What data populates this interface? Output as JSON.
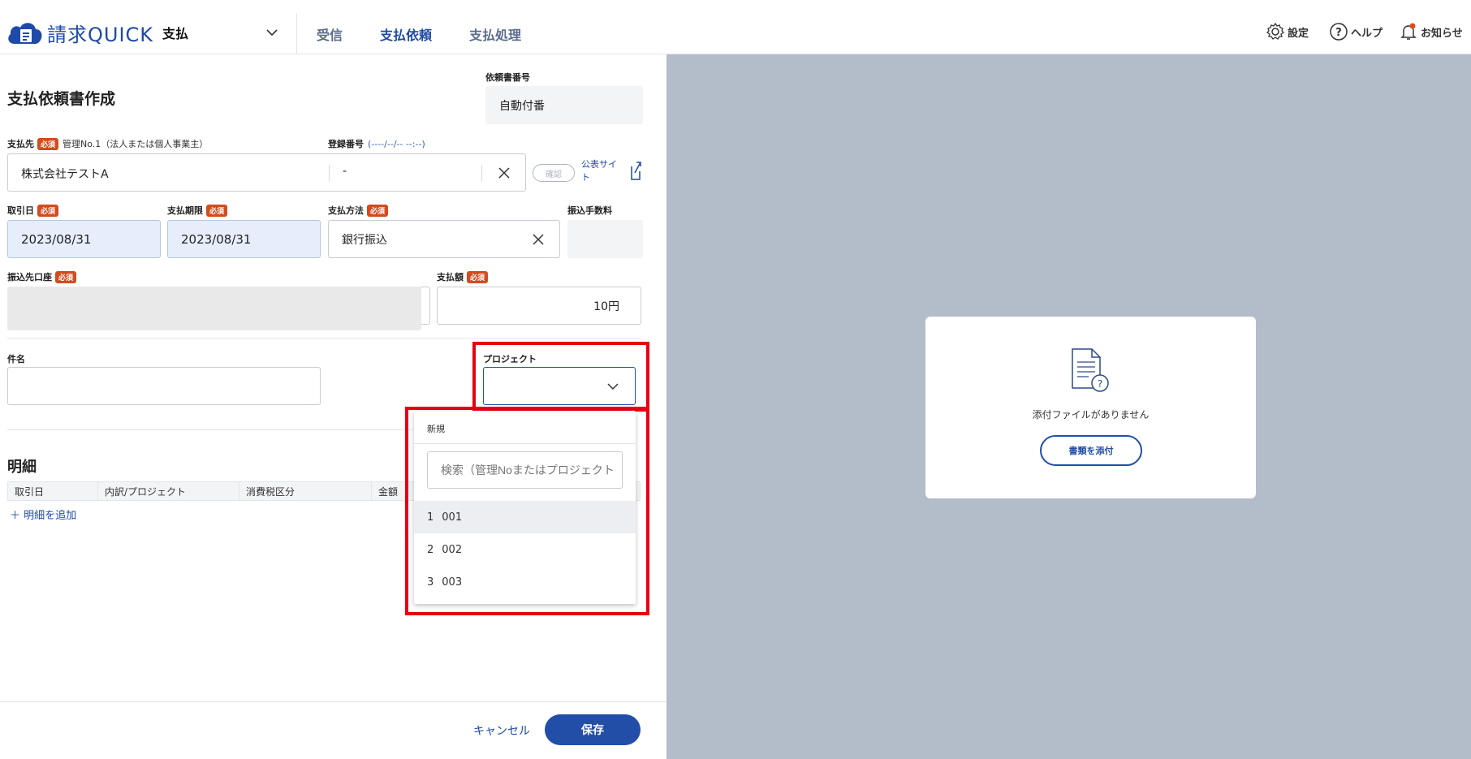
{
  "app": {
    "name": "請求QUICK",
    "module": "支払"
  },
  "nav": {
    "tabs": [
      "受信",
      "支払依頼",
      "支払処理"
    ],
    "active": "支払依頼"
  },
  "header_tools": {
    "settings": "設定",
    "help": "ヘルプ",
    "notifications": "お知らせ"
  },
  "form": {
    "title": "支払依頼書作成",
    "request_no": {
      "label": "依頼書番号",
      "value": "自動付番"
    },
    "payee": {
      "label": "支払先",
      "required": "必須",
      "sub": "管理No.1（法人または個人事業主）",
      "value": "株式会社テストA"
    },
    "reg_no": {
      "label": "登録番号",
      "format": "(----/--/-- --:--)",
      "value": "-",
      "confirm": "確認",
      "public_site": "公表サイト"
    },
    "trade_date": {
      "label": "取引日",
      "required": "必須",
      "value": "2023/08/31"
    },
    "due_date": {
      "label": "支払期限",
      "required": "必須",
      "value": "2023/08/31"
    },
    "method": {
      "label": "支払方法",
      "required": "必須",
      "value": "銀行振込"
    },
    "fee": {
      "label": "振込手数料",
      "value": ""
    },
    "account": {
      "label": "振込先口座",
      "required": "必須",
      "value": ""
    },
    "amount": {
      "label": "支払額",
      "required": "必須",
      "value": "10円"
    },
    "subject": {
      "label": "件名",
      "value": ""
    },
    "project": {
      "label": "プロジェクト",
      "value": "",
      "menu": {
        "new_label": "新規",
        "search_placeholder": "検索（管理Noまたはプロジェクト",
        "options": [
          {
            "num": "1",
            "name": "001",
            "highlighted": true
          },
          {
            "num": "2",
            "name": "002",
            "highlighted": false
          },
          {
            "num": "3",
            "name": "003",
            "highlighted": false
          }
        ]
      }
    }
  },
  "details": {
    "title": "明細",
    "columns": [
      "取引日",
      "内訳/プロジェクト",
      "消費税区分",
      "金額"
    ],
    "add_label": "＋ 明細を追加"
  },
  "footer": {
    "cancel": "キャンセル",
    "save": "保存"
  },
  "preview": {
    "empty_message": "添付ファイルがありません",
    "attach_button": "書類を添付"
  }
}
